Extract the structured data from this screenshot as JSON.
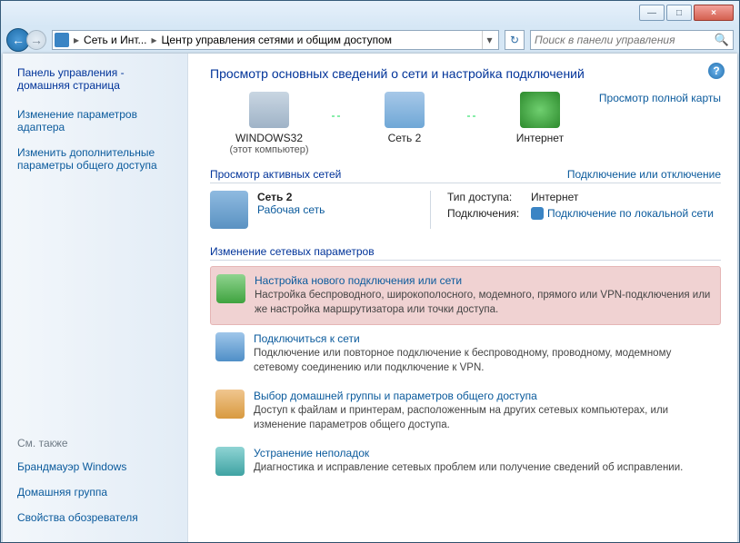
{
  "titlebar": {
    "minimize": "—",
    "maximize": "□",
    "close": "×"
  },
  "nav": {
    "crumb1": "Сеть и Инт...",
    "crumb2": "Центр управления сетями и общим доступом",
    "search_placeholder": "Поиск в панели управления"
  },
  "sidebar": {
    "home_title": "Панель управления - домашняя страница",
    "links": [
      "Изменение параметров адаптера",
      "Изменить дополнительные параметры общего доступа"
    ],
    "also_title": "См. также",
    "also": [
      "Брандмауэр Windows",
      "Домашняя группа",
      "Свойства обозревателя"
    ]
  },
  "main": {
    "heading": "Просмотр основных сведений о сети и настройка подключений",
    "full_map": "Просмотр полной карты",
    "map": {
      "pc_name": "WINDOWS32",
      "pc_sub": "(этот компьютер)",
      "net_name": "Сеть  2",
      "inet_name": "Интернет"
    },
    "active_hdr": "Просмотр активных сетей",
    "conn_toggle": "Подключение или отключение",
    "active": {
      "name": "Сеть  2",
      "type": "Рабочая сеть",
      "kv_access_k": "Тип доступа:",
      "kv_access_v": "Интернет",
      "kv_conn_k": "Подключения:",
      "kv_conn_v": "Подключение по локальной сети"
    },
    "params_hdr": "Изменение сетевых параметров",
    "tasks": [
      {
        "title": "Настройка нового подключения или сети",
        "desc": "Настройка беспроводного, широкополосного, модемного, прямого или VPN-подключения или же настройка маршрутизатора или точки доступа."
      },
      {
        "title": "Подключиться к сети",
        "desc": "Подключение или повторное подключение к беспроводному, проводному, модемному сетевому соединению или подключение к VPN."
      },
      {
        "title": "Выбор домашней группы и параметров общего доступа",
        "desc": "Доступ к файлам и принтерам, расположенным на других сетевых компьютерах, или изменение параметров общего доступа."
      },
      {
        "title": "Устранение неполадок",
        "desc": "Диагностика и исправление сетевых проблем или получение сведений об исправлении."
      }
    ]
  }
}
